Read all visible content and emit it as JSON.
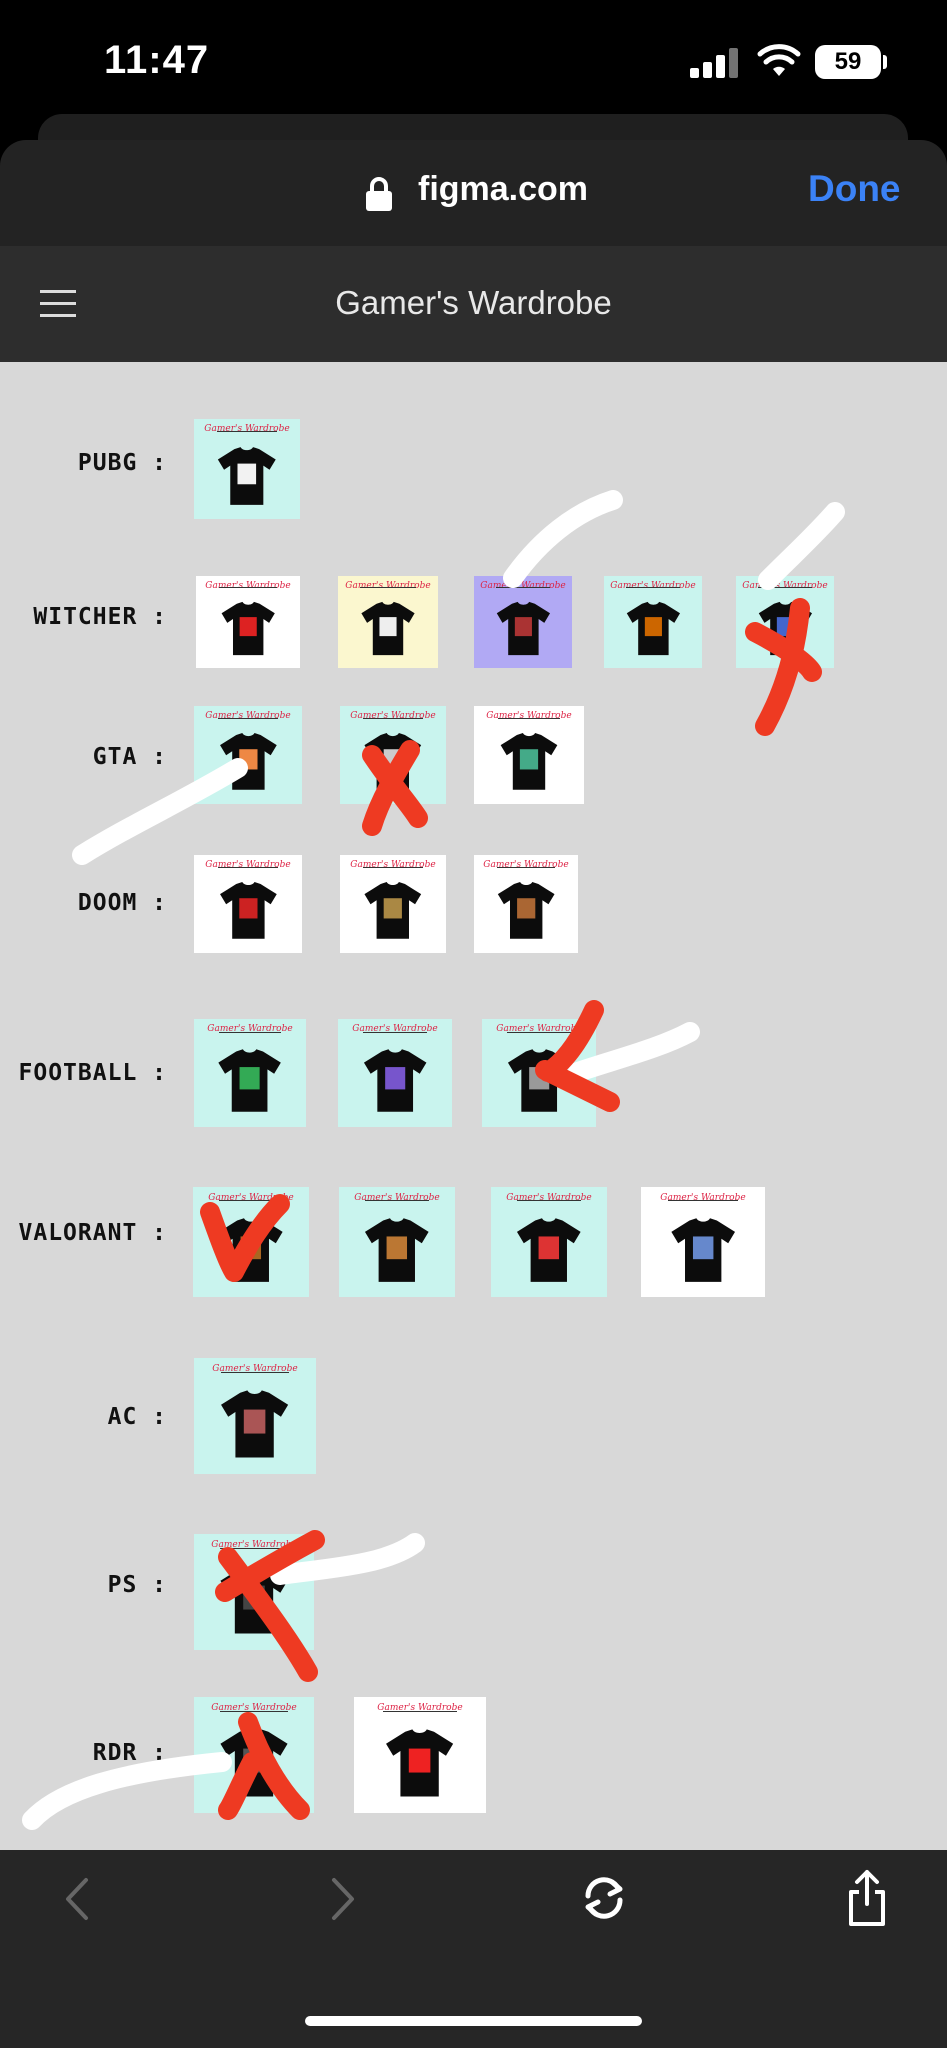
{
  "status_bar": {
    "time": "11:47",
    "battery": "59"
  },
  "browser": {
    "url": "figma.com",
    "done_label": "Done"
  },
  "prototype": {
    "title": "Gamer's Wardrobe"
  },
  "card_brand": "Gamer's Wardrobe",
  "rows": [
    {
      "label": "PUBG :"
    },
    {
      "label": "WITCHER :"
    },
    {
      "label": "GTA :"
    },
    {
      "label": "DOOM :"
    },
    {
      "label": "FOOTBALL :"
    },
    {
      "label": "VALORANT :"
    },
    {
      "label": "AC :"
    },
    {
      "label": "PS :"
    },
    {
      "label": "RDR :"
    }
  ],
  "colors": {
    "mint": "#c9f4ee",
    "white": "#ffffff",
    "cream": "#fbf7cf",
    "lavender": "#b1a9f4",
    "annotation_red": "#ee3a22",
    "annotation_white": "#ffffff",
    "link_blue": "#3b82f6"
  },
  "icons": {
    "back": "chevron-left-icon",
    "forward": "chevron-right-icon",
    "reload": "reload-icon",
    "share": "share-icon",
    "menu": "hamburger-menu-icon",
    "lock": "lock-icon"
  }
}
